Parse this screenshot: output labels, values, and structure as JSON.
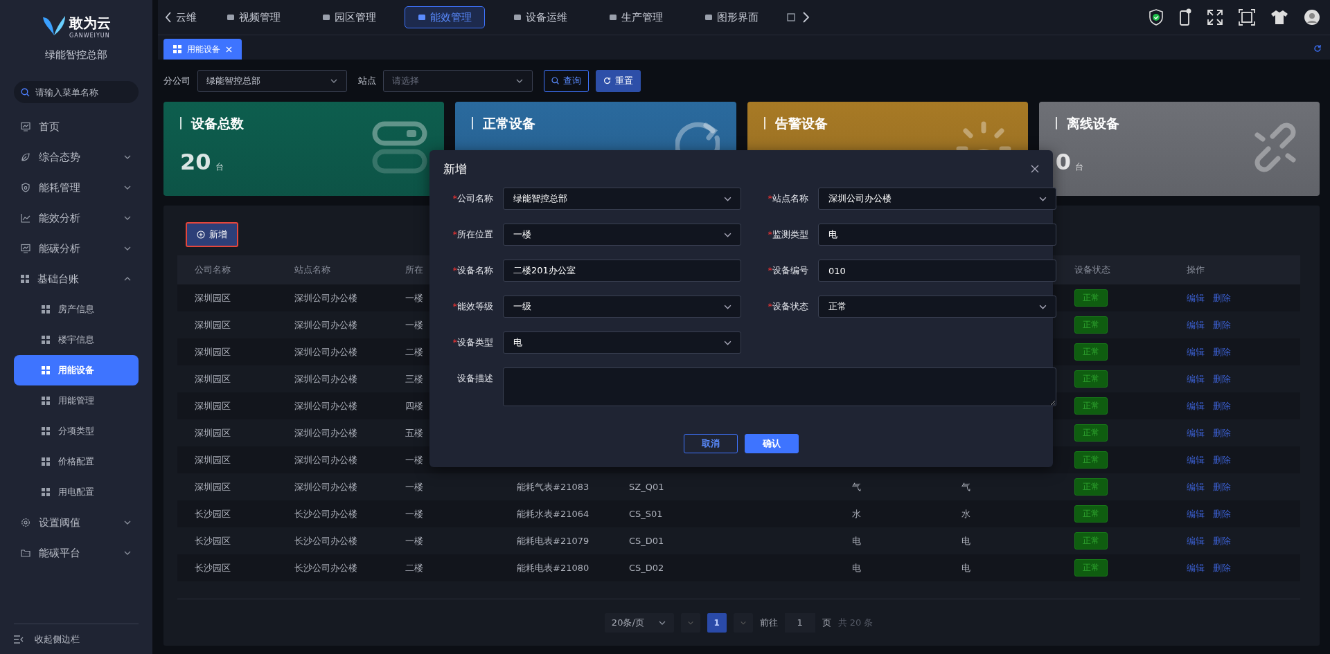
{
  "sidebar": {
    "brand": {
      "name": "敢为云",
      "sub": "GANWEIYUN"
    },
    "org": "绿能智控总部",
    "search": {
      "placeholder": "请输入菜单名称"
    },
    "items": [
      {
        "label": "首页",
        "selected": false
      },
      {
        "label": "综合态势",
        "expanded": false,
        "selected": false
      },
      {
        "label": "能耗管理",
        "expanded": false,
        "selected": false
      },
      {
        "label": "能效分析",
        "expanded": false,
        "selected": false
      },
      {
        "label": "能碳分析",
        "expanded": false,
        "selected": false
      },
      {
        "label": "基础台账",
        "expanded": true,
        "selected": false,
        "children": [
          {
            "label": "房产信息",
            "selected": false
          },
          {
            "label": "楼宇信息",
            "selected": false
          },
          {
            "label": "用能设备",
            "selected": true
          },
          {
            "label": "用能管理",
            "selected": false
          },
          {
            "label": "分项类型",
            "selected": false
          },
          {
            "label": "价格配置",
            "selected": false
          },
          {
            "label": "用电配置",
            "selected": false
          }
        ]
      },
      {
        "label": "设置阈值",
        "expanded": false,
        "selected": false
      },
      {
        "label": "能碳平台",
        "expanded": false,
        "selected": false
      }
    ],
    "collapse": "收起侧边栏"
  },
  "topnav": {
    "back": "云维",
    "items": [
      {
        "label": "视频管理",
        "selected": false
      },
      {
        "label": "园区管理",
        "selected": false
      },
      {
        "label": "能效管理",
        "selected": true
      },
      {
        "label": "设备运维",
        "selected": false
      },
      {
        "label": "生产管理",
        "selected": false
      },
      {
        "label": "图形界面",
        "selected": false
      }
    ]
  },
  "tabs": [
    {
      "label": "用能设备",
      "selected": true
    }
  ],
  "filters": [
    {
      "label": "分公司",
      "value": "绿能智控总部"
    },
    {
      "label": "站点",
      "placeholder": "请选择"
    }
  ],
  "filter_buttons": [
    {
      "kind": "query",
      "label": "查询"
    },
    {
      "kind": "reset",
      "label": "重置"
    }
  ],
  "cards": [
    {
      "title": "设备总数",
      "value": "20",
      "unit": "台",
      "color": "#0d5e4e",
      "kind": "total"
    },
    {
      "title": "正常设备",
      "color": "#2a6a9e",
      "kind": "normal"
    },
    {
      "title": "告警设备",
      "color": "#a87a25",
      "kind": "alarm"
    },
    {
      "title": "离线设备",
      "value": "0",
      "unit": "台",
      "color": "#6e7076",
      "kind": "offline"
    }
  ],
  "add_button": "新增",
  "table": {
    "columns": [
      "公司名称",
      "站点名称",
      "所在",
      null,
      null,
      null,
      null,
      null,
      "设备状态",
      "操作"
    ],
    "rows": [
      {
        "cells": [
          "深圳园区",
          "深圳公司办公楼",
          "一楼",
          null,
          null,
          null,
          null,
          null
        ],
        "status": "正常",
        "actions": [
          "编辑",
          "删除"
        ]
      },
      {
        "cells": [
          "深圳园区",
          "深圳公司办公楼",
          "一楼",
          null,
          null,
          null,
          null,
          null
        ],
        "status": "正常",
        "actions": [
          "编辑",
          "删除"
        ]
      },
      {
        "cells": [
          "深圳园区",
          "深圳公司办公楼",
          "二楼",
          null,
          null,
          null,
          null,
          null
        ],
        "status": "正常",
        "actions": [
          "编辑",
          "删除"
        ]
      },
      {
        "cells": [
          "深圳园区",
          "深圳公司办公楼",
          "三楼",
          null,
          null,
          null,
          null,
          null
        ],
        "status": "正常",
        "actions": [
          "编辑",
          "删除"
        ]
      },
      {
        "cells": [
          "深圳园区",
          "深圳公司办公楼",
          "四楼",
          null,
          null,
          null,
          null,
          null
        ],
        "status": "正常",
        "actions": [
          "编辑",
          "删除"
        ]
      },
      {
        "cells": [
          "深圳园区",
          "深圳公司办公楼",
          "五楼",
          null,
          null,
          null,
          null,
          null
        ],
        "status": "正常",
        "actions": [
          "编辑",
          "删除"
        ]
      },
      {
        "cells": [
          "深圳园区",
          "深圳公司办公楼",
          "一楼",
          null,
          null,
          null,
          null,
          null
        ],
        "status": "正常",
        "actions": [
          "编辑",
          "删除"
        ]
      },
      {
        "cells": [
          "深圳园区",
          "深圳公司办公楼",
          "一楼",
          "能耗气表#21083",
          "SZ_Q01",
          null,
          "气",
          "气"
        ],
        "status": "正常",
        "actions": [
          "编辑",
          "删除"
        ]
      },
      {
        "cells": [
          "长沙园区",
          "长沙公司办公楼",
          "一楼",
          "能耗水表#21064",
          "CS_S01",
          null,
          "水",
          "水"
        ],
        "status": "正常",
        "actions": [
          "编辑",
          "删除"
        ]
      },
      {
        "cells": [
          "长沙园区",
          "长沙公司办公楼",
          "一楼",
          "能耗电表#21079",
          "CS_D01",
          null,
          "电",
          "电"
        ],
        "status": "正常",
        "actions": [
          "编辑",
          "删除"
        ]
      },
      {
        "cells": [
          "长沙园区",
          "长沙公司办公楼",
          "二楼",
          "能耗电表#21080",
          "CS_D02",
          null,
          "电",
          "电"
        ],
        "status": "正常",
        "actions": [
          "编辑",
          "删除"
        ]
      }
    ]
  },
  "pagination": {
    "page_size": "20条/页",
    "pages": [
      {
        "label": "1",
        "selected": true
      }
    ],
    "goto": "前往",
    "goto_value": "1",
    "page_word": "页",
    "total": "共 20 条"
  },
  "modal": {
    "title": "新增",
    "fields": [
      {
        "mark": "*",
        "label": "公司名称",
        "kind": "select",
        "value": "绿能智控总部"
      },
      {
        "mark": "*",
        "label": "站点名称",
        "kind": "select",
        "value": "深圳公司办公楼"
      },
      {
        "mark": "*",
        "label": "所在位置",
        "kind": "select",
        "value": "一楼"
      },
      {
        "mark": "*",
        "label": "监测类型",
        "kind": "input",
        "value": "电"
      },
      {
        "mark": "*",
        "label": "设备名称",
        "kind": "input",
        "value": "二楼201办公室"
      },
      {
        "mark": "*",
        "label": "设备编号",
        "kind": "input",
        "value": "010"
      },
      {
        "mark": "*",
        "label": "能效等级",
        "kind": "select",
        "value": "一级"
      },
      {
        "mark": "*",
        "label": "设备状态",
        "kind": "select",
        "value": "正常"
      },
      {
        "mark": "*",
        "label": "设备类型",
        "kind": "select",
        "value": "电"
      },
      {
        "label": "设备描述",
        "kind": "textarea"
      }
    ],
    "buttons": [
      {
        "kind": "cancel",
        "label": "取消"
      },
      {
        "kind": "confirm",
        "label": "确认"
      }
    ]
  }
}
